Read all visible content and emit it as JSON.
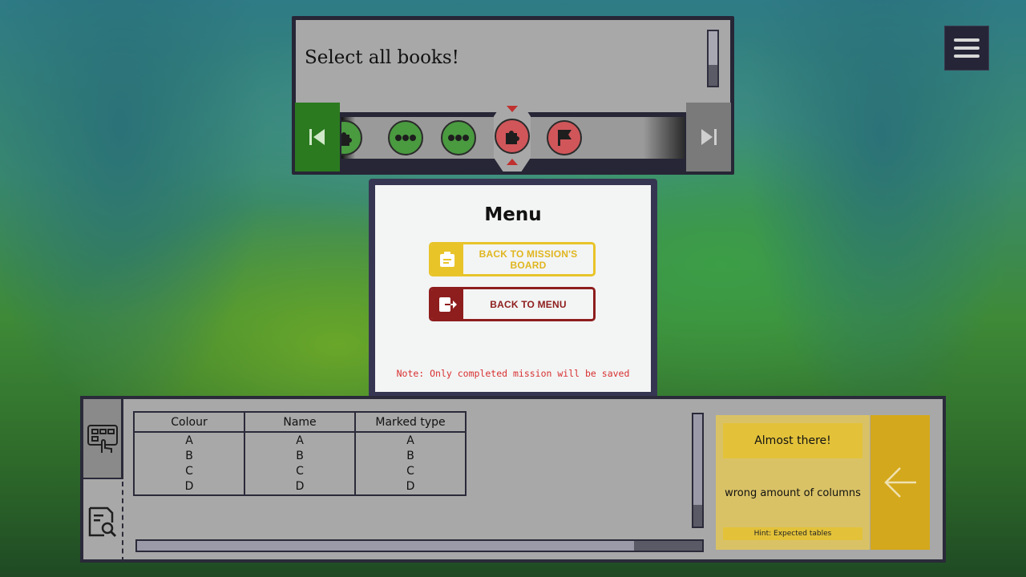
{
  "instruction": {
    "text": "Select all books!"
  },
  "navigation": {
    "steps": [
      {
        "icon": "puzzle-icon",
        "status": "completed"
      },
      {
        "icon": "dots-icon",
        "status": "completed"
      },
      {
        "icon": "dots-icon",
        "status": "completed"
      },
      {
        "icon": "puzzle-icon",
        "status": "current"
      },
      {
        "icon": "flag-icon",
        "status": "pending"
      }
    ]
  },
  "menu": {
    "title": "Menu",
    "mission_board_label": "Back to mission's board",
    "back_to_menu_label": "Back to menu",
    "note": "Note: Only completed mission will be saved"
  },
  "result_table": {
    "columns": [
      "Colour",
      "Name",
      "Marked type"
    ],
    "rows": [
      [
        "A",
        "A",
        "A"
      ],
      [
        "B",
        "B",
        "B"
      ],
      [
        "C",
        "C",
        "C"
      ],
      [
        "D",
        "D",
        "D"
      ]
    ]
  },
  "feedback": {
    "title": "Almost there!",
    "message": "wrong amount of columns",
    "hint": "Hint: Expected tables"
  },
  "colors": {
    "completed": "#4a9a40",
    "pending": "#d0565a",
    "mission_button": "#e8c429",
    "menu_button": "#8e1d1d"
  }
}
